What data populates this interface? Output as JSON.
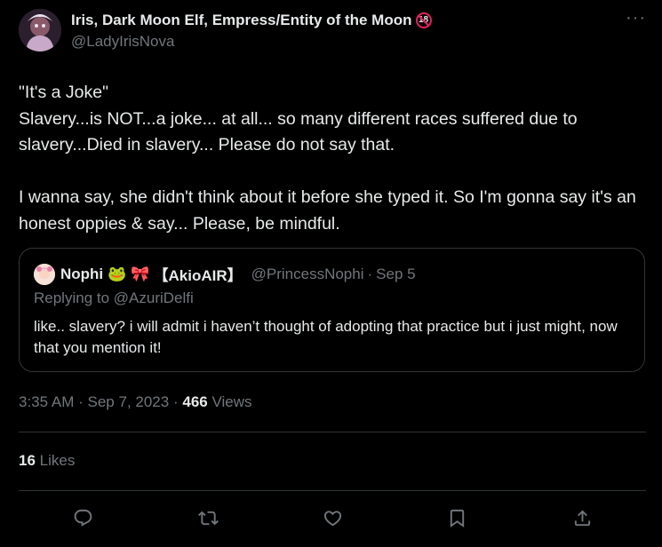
{
  "author": {
    "name": "Iris, Dark Moon Elf, Empress/Entity of the Moon",
    "badge": "18",
    "handle": "@LadyIrisNova"
  },
  "more_icon": "more-icon",
  "tweet": {
    "text": "\"It's a Joke\"\nSlavery...is NOT...a joke... at all... so many different races suffered due to slavery...Died in slavery... Please do not say that.\n\nI wanna say, she didn't think about it before she typed it. So I'm gonna say it's an honest oppies & say... Please, be mindful."
  },
  "quote": {
    "name": "Nophi",
    "emoji1": "🐸",
    "emoji2": "🎀",
    "tag": "【AkioAIR】",
    "handle": "@PrincessNophi",
    "separator": "·",
    "date": "Sep 5",
    "replying_to": "Replying to @AzuriDelfi",
    "text": "like.. slavery? i will admit i haven’t thought of adopting that practice but i just might, now that you mention it!"
  },
  "meta": {
    "time": "3:35 AM",
    "separator": "·",
    "date": "Sep 7, 2023",
    "views_count": "466",
    "views_label": "Views"
  },
  "likes": {
    "count": "16",
    "label": "Likes"
  },
  "actions": {
    "reply": "reply-icon",
    "retweet": "retweet-icon",
    "like": "like-icon",
    "bookmark": "bookmark-icon",
    "share": "share-icon"
  },
  "colors": {
    "background": "#000000",
    "text": "#e7e9ea",
    "muted": "#71767b",
    "border": "#333639",
    "badge_red": "#e0245e"
  }
}
